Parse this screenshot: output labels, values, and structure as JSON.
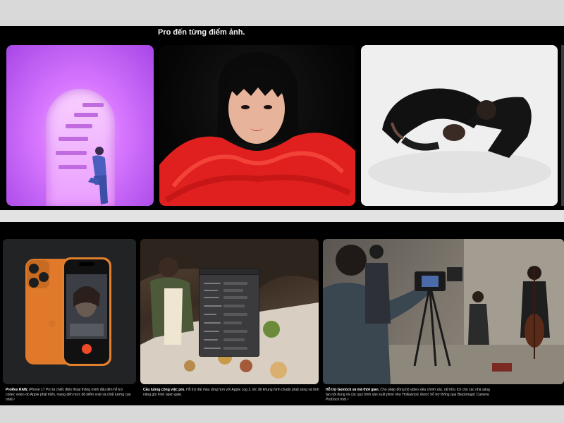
{
  "section": {
    "headline": "Pro đến từng điểm ảnh."
  },
  "photos": [
    {
      "name": "purple-staircase-photo"
    },
    {
      "name": "red-fur-portrait-photo"
    },
    {
      "name": "bw-pose-photo"
    }
  ],
  "cards": [
    {
      "title": "ProRes RAW.",
      "body": "iPhone 17 Pro là chiếc điện thoại thông minh đầu tiên hỗ trợ codec video do Apple phát triển, mang đến mức độ kiểm soát và chất lượng cao nhất.²"
    },
    {
      "title": "Cầu luồng công việc pro.",
      "body": "Hỗ trợ dải màu rộng hơn với Apple Log 2, tốc độ khung hình chuẩn phát sóng và tính năng ghi hình open gate."
    },
    {
      "title": "Hỗ trợ Genlock và mã thời gian.",
      "body": "Cho phép đồng bộ video siêu chính xác, rất hữu ích cho các nhà sáng tạo nội dung và các quy trình sản xuất phim như Hollywood. Được hỗ trợ thông qua Blackmagic Camera ProDock mới.³"
    }
  ],
  "colors": {
    "background": "#d9d9d9",
    "band": "#000000",
    "accent_purple": "#d777ff",
    "accent_red": "#e01f1f",
    "phone_orange": "#e07a2a"
  }
}
